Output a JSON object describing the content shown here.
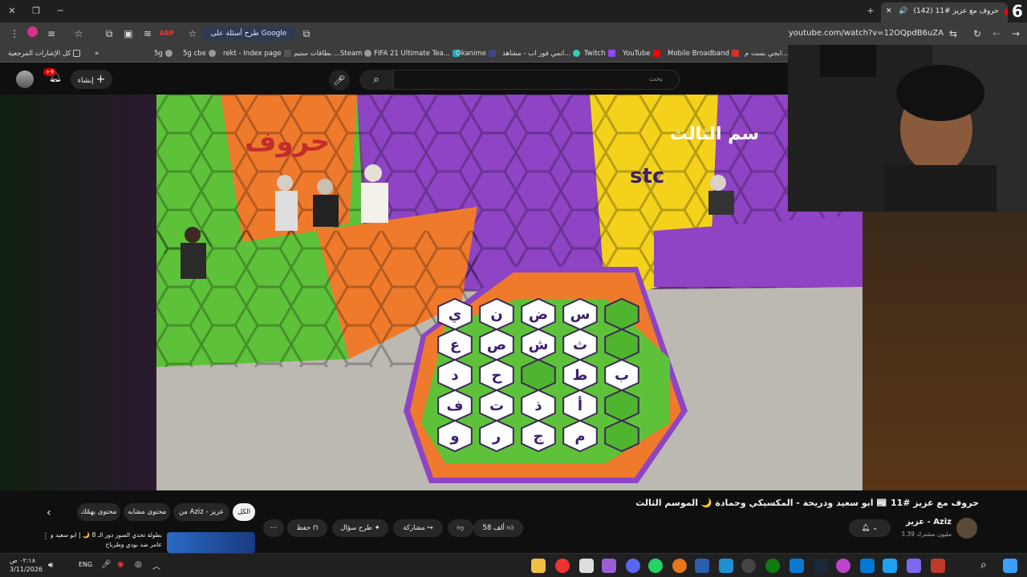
{
  "browser": {
    "tab_title": "(142) حروف مع عزيز #11",
    "badge": "6",
    "url": "youtube.com/watch?v=12OQpdB6uZA",
    "google_pill": "طرح أسئلة على Google",
    "bookmarks": [
      "كل الإشارات المرجعية",
      "5g",
      "5g cbe",
      "rekt - Index page",
      "بطاقات ستيم ...Steam",
      "FIFA 21 Ultimate Tea...",
      "Okanime",
      "انمي فور اب - مشاهد...",
      "Twitch",
      "YouTube",
      "Mobile Broadband",
      "ايجي بست م..."
    ]
  },
  "youtube": {
    "search_placeholder": "بحث",
    "create_label": "إنشاء",
    "notif_count": "+9",
    "video_title": "حروف مع عزيز #11 📰 ابو سعيد ودريحة - المكسيكي وحمادة 🌙 الموسم الثالث",
    "channel_name": "عزيز - Aziz",
    "subscribers": "3.39 مليون مشترك",
    "likes": "58 ألف",
    "share": "مشاركة",
    "ask": "طرح سؤال",
    "save": "حفظ",
    "chips": [
      "الكل",
      "من Aziz - عزيز",
      "محتوى مشابه",
      "محتوى يهمّك"
    ],
    "next_video_title": "بطولة تحدي الصور دور الـ 8 🌙 | ابو سعيد و عامر ضد بودي وطرباح"
  },
  "board": {
    "rows": [
      [
        "ي",
        "ن",
        "ض",
        "س",
        ""
      ],
      [
        "ع",
        "ص",
        "ش",
        "ث",
        ""
      ],
      [
        "د",
        "ح",
        "",
        "ط",
        "ب"
      ],
      [
        "ف",
        "ت",
        "ذ",
        "أ",
        ""
      ],
      [
        "و",
        "ر",
        "ج",
        "م",
        ""
      ]
    ]
  },
  "taskbar": {
    "time": "٠٢:١٨ ص",
    "date": "3/11/2026",
    "lang": "ENG"
  },
  "colors": {
    "accent": "#ff0000",
    "green": "#5ec13a",
    "orange": "#f07a2c",
    "purple": "#8e44c4",
    "yellow": "#f4d21c"
  }
}
